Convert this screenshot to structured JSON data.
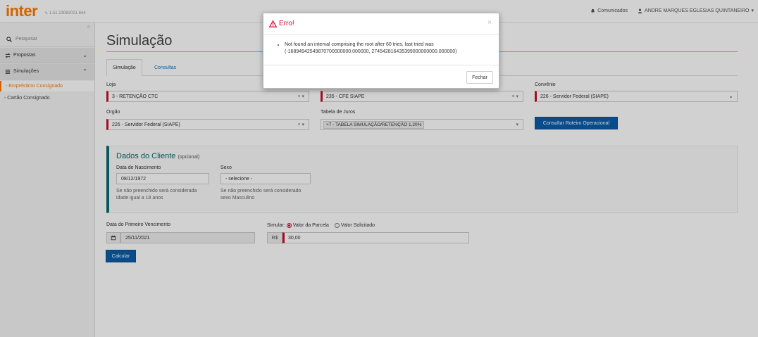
{
  "header": {
    "logo": "inter",
    "version": "v. 1.51.13082021.644",
    "notices": "Comunicados",
    "user": "ANDRE MARQUES EGLESIAS QUINTANEIRO",
    "user_caret": "▾"
  },
  "sidebar": {
    "search_placeholder": "Pesquisar",
    "collapse_glyph": "«",
    "menus": [
      {
        "label": "Propostas",
        "chevron": "⌄"
      },
      {
        "label": "Simulações",
        "chevron": "⌃"
      }
    ],
    "subitems": [
      {
        "label": "- Empréstimo Consignado"
      },
      {
        "label": "- Cartão Consignado"
      }
    ]
  },
  "main": {
    "title": "Simulação",
    "tabs": [
      {
        "label": "Simulação"
      },
      {
        "label": "Consultas"
      }
    ],
    "loja": {
      "label": "Loja",
      "value": "3 - RETENÇÃO CTC",
      "clear": "× ▾"
    },
    "middle_select": {
      "value": "235 - CFE SIAPE",
      "clear": "× ▾"
    },
    "convenio": {
      "label": "Convênio",
      "value": "226 - Servidor Federal (SIAPE)",
      "chevron": "⌄"
    },
    "orgao": {
      "label": "Órgão",
      "value": "226 - Servidor Federal (SIAPE)",
      "clear": "× ▾"
    },
    "tabela": {
      "label": "Tabela de Juros",
      "tag": "×7 - TABELA SIMULAÇÃO/RETENÇÃO 1,20%",
      "caret": "▾"
    },
    "roteiro_button": "Consultar Roteiro Operacional",
    "client": {
      "title": "Dados do Cliente",
      "optional": "(opcional)",
      "birth_label": "Data de Nascimento",
      "birth_value": "08/12/1972",
      "birth_hint_1": "Se não preenchido será considerada",
      "birth_hint_2": "idade igual a 18 anos",
      "sex_label": "Sexo",
      "sex_value": "- selecione -",
      "sex_hint_1": "Se não preenchido será considerado",
      "sex_hint_2": "sexo Masculino"
    },
    "first_due_label": "Data do Primeiro Vencimento",
    "first_due_value": "25/11/2021",
    "simular_label": "Simular:",
    "radio_parcela": "Valor da Parcela",
    "radio_solicitado": "Valor Solicitado",
    "currency": "R$",
    "amount": "30,00",
    "calc_button": "Calcular"
  },
  "modal": {
    "title": "Erro!",
    "close": "×",
    "message": "Not found an interval comprising the root after 60 tries, last tried was (-16894942549870700000000.000000, 274542816435399000000000.000000)",
    "ok_button": "Fechar"
  },
  "colors": {
    "brand": "#ff7a00",
    "primary": "#0b5da8",
    "error": "#c8102e",
    "client_accent": "#0b6b6f"
  }
}
